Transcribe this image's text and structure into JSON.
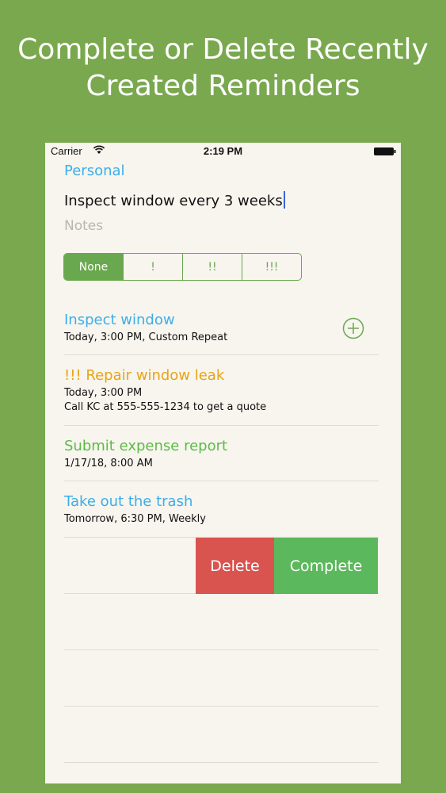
{
  "headline": {
    "line1": "Complete or Delete Recently",
    "line2": "Created Reminders"
  },
  "status_bar": {
    "carrier": "Carrier",
    "time": "2:19 PM"
  },
  "list_title": "Personal",
  "new_reminder": {
    "value": "Inspect window every 3 weeks",
    "notes_placeholder": "Notes"
  },
  "priority": {
    "options": [
      "None",
      "!",
      "!!",
      "!!!"
    ],
    "selected": "None"
  },
  "reminders": [
    {
      "title": "Inspect window",
      "subtitle": "Today, 3:00 PM, Custom Repeat",
      "color": "#3daee9"
    },
    {
      "title": "!!! Repair window leak",
      "subtitle": "Today, 3:00 PM",
      "note": "Call KC at 555-555-1234 to get a quote",
      "color": "#e8a317"
    },
    {
      "title": "Submit expense report",
      "subtitle": "1/17/18, 8:00 AM",
      "color": "#5dbb47"
    },
    {
      "title": "Take out the trash",
      "subtitle": "Tomorrow, 6:30 PM, Weekly",
      "color": "#3daee9"
    }
  ],
  "swipe_actions": {
    "delete_label": "Delete",
    "complete_label": "Complete"
  },
  "colors": {
    "background": "#7aa84e",
    "accent_green": "#6aa84f",
    "delete_red": "#d9534f",
    "complete_green": "#5cb85c"
  },
  "icons": {
    "wifi": "wifi-icon",
    "battery": "battery-icon",
    "add": "plus-circle-icon"
  }
}
